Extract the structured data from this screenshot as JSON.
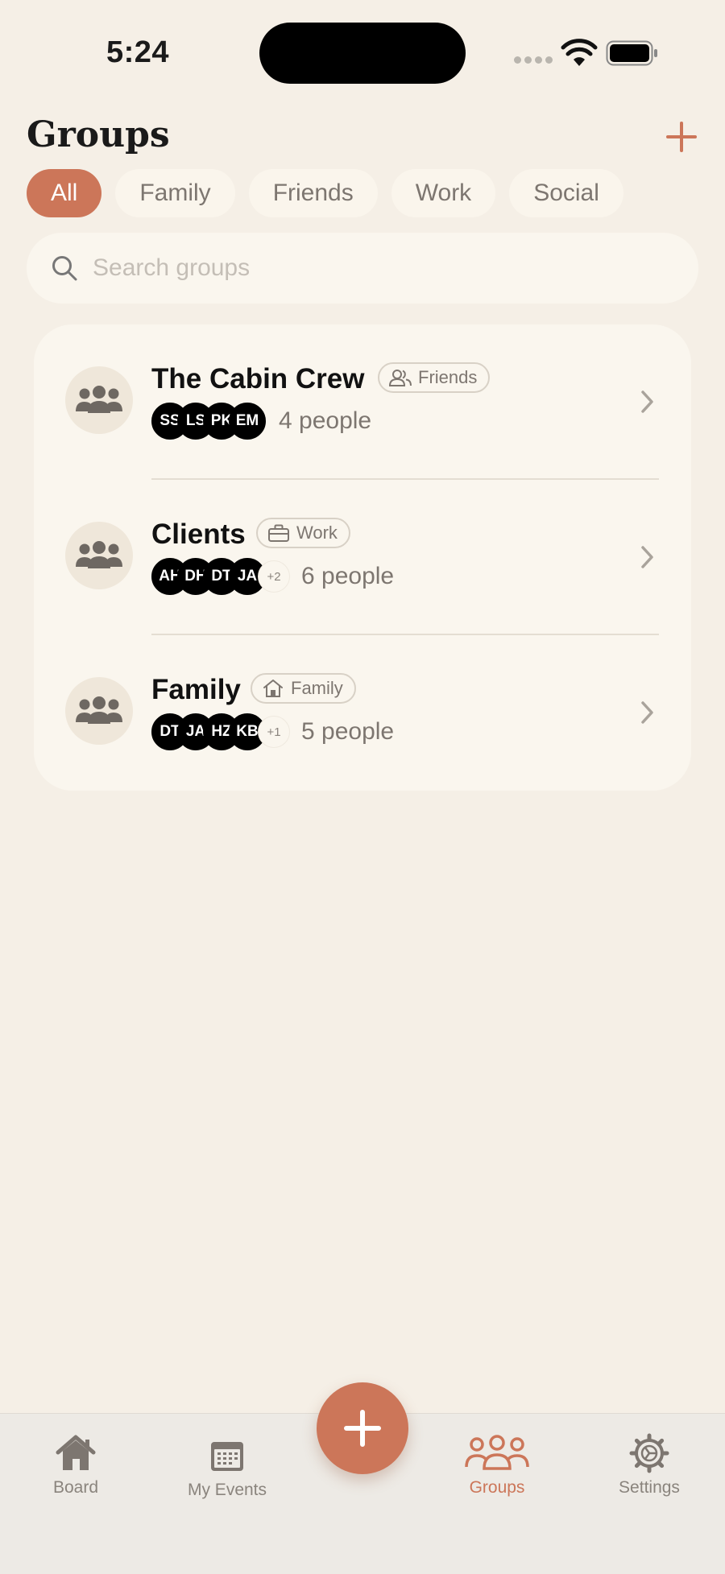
{
  "status": {
    "time": "5:24"
  },
  "header": {
    "title": "Groups"
  },
  "filters": [
    "All",
    "Family",
    "Friends",
    "Work",
    "Social"
  ],
  "search": {
    "placeholder": "Search groups",
    "value": ""
  },
  "groups": [
    {
      "name": "The Cabin Crew",
      "tag": "Friends",
      "tag_icon": "people-icon",
      "members": [
        "SS",
        "LS",
        "PK",
        "EM"
      ],
      "more": "",
      "count": "4 people"
    },
    {
      "name": "Clients",
      "tag": "Work",
      "tag_icon": "briefcase-icon",
      "members": [
        "AH",
        "DH",
        "DT",
        "JA"
      ],
      "more": "+2",
      "count": "6 people"
    },
    {
      "name": "Family",
      "tag": "Family",
      "tag_icon": "home-icon",
      "members": [
        "DT",
        "JA",
        "HZ",
        "KB"
      ],
      "more": "+1",
      "count": "5 people"
    }
  ],
  "tabs": [
    {
      "label": "Board",
      "icon": "home-icon"
    },
    {
      "label": "My Events",
      "icon": "calendar-icon"
    },
    {
      "label": "Groups",
      "icon": "groups-icon",
      "active": true
    },
    {
      "label": "Settings",
      "icon": "gear-icon"
    }
  ],
  "colors": {
    "accent": "#CC7659",
    "background": "#F5EFE6",
    "card": "#FAF6EE"
  }
}
